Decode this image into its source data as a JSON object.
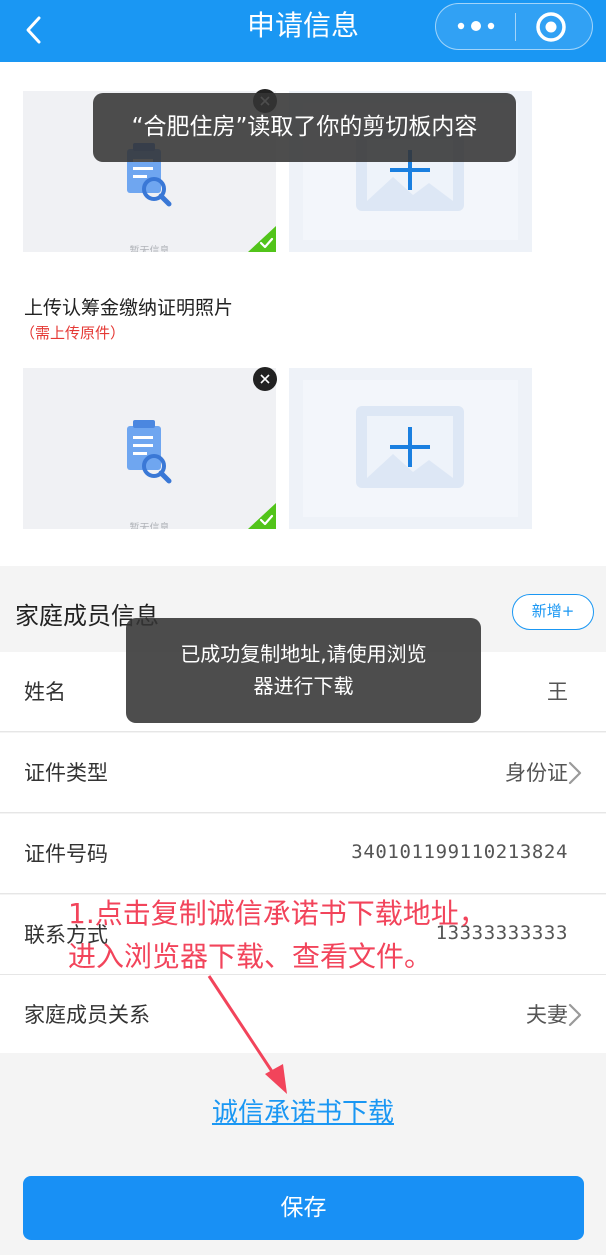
{
  "header": {
    "title": "申请信息"
  },
  "upload": {
    "placeholder_text": "暂无信息",
    "section2_label": "上传认筹金缴纳证明照片",
    "section2_note": "（需上传原件）"
  },
  "toast_clipboard": "“合肥住房”读取了你的剪切板内容",
  "family": {
    "title": "家庭成员信息",
    "add_label": "新增+",
    "rows": [
      {
        "label": "姓名",
        "value": "王"
      },
      {
        "label": "证件类型",
        "value": "身份证"
      },
      {
        "label": "证件号码",
        "value": "340101199110213824"
      },
      {
        "label": "联系方式",
        "value": "13333333333"
      },
      {
        "label": "家庭成员关系",
        "value": "夫妻"
      }
    ]
  },
  "toast_copy": {
    "line1": "已成功复制地址,请使用浏览",
    "line2": "器进行下载"
  },
  "annotation": {
    "line1": "1.点击复制诚信承诺书下载地址，",
    "line2": "进入浏览器下载、查看文件。"
  },
  "download_link": "诚信承诺书下载",
  "save_label": "保存",
  "colors": {
    "primary": "#1a97f3",
    "accent_red": "#f2445b",
    "check_green": "#52c41a"
  }
}
